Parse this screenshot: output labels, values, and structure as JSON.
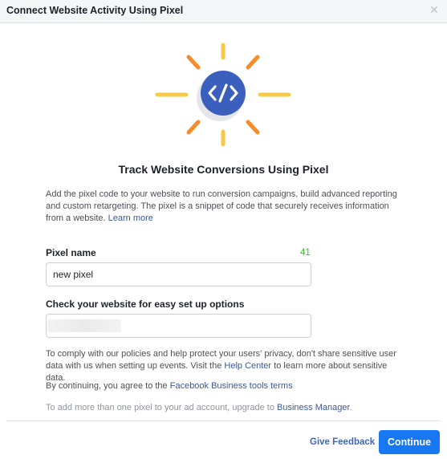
{
  "dialog": {
    "title": "Connect Website Activity Using Pixel",
    "close_icon": "close-icon"
  },
  "hero": {
    "icon": "code-brackets-icon",
    "glyph": "</>",
    "colors": {
      "circle": "#3b5fbd",
      "rays_yellow": "#f7c948",
      "rays_orange": "#f58d2e"
    }
  },
  "section": {
    "title": "Track Website Conversions Using Pixel",
    "description": "Add the pixel code to your website to run conversion campaigns, build advanced reporting and custom retargeting. The pixel is a snippet of code that securely receives information from a website.",
    "learn_more": "Learn more"
  },
  "pixel_name": {
    "label": "Pixel name",
    "char_count": "41",
    "value": "new pixel"
  },
  "website": {
    "label": "Check your website for easy set up options",
    "value": ""
  },
  "privacy": {
    "text": "To comply with our policies and help protect your users' privacy, don't share sensitive user data with us when setting up events. Visit the",
    "link": "Help Center",
    "suffix": "to learn more about sensitive data."
  },
  "terms": {
    "text": "By continuing, you agree to the",
    "link": "Facebook Business tools terms"
  },
  "upgrade": {
    "text": "To add more than one pixel to your ad account, upgrade to",
    "link": "Business Manager",
    "suffix": "."
  },
  "footer": {
    "feedback_label": "Give Feedback",
    "continue_label": "Continue"
  }
}
